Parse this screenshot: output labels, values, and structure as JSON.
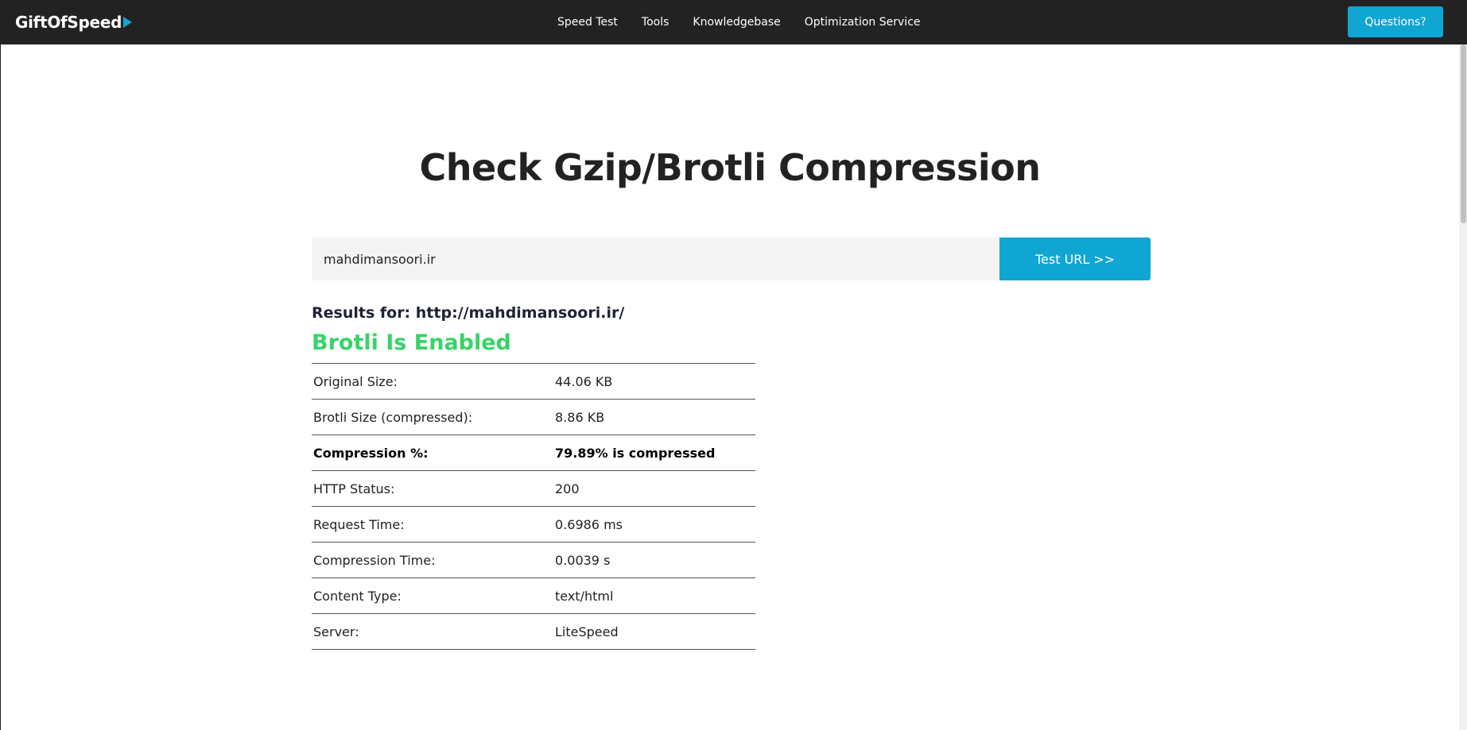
{
  "header": {
    "logo_text": "GiftOfSpeed",
    "nav": [
      {
        "label": "Speed Test"
      },
      {
        "label": "Tools"
      },
      {
        "label": "Knowledgebase"
      },
      {
        "label": "Optimization Service"
      }
    ],
    "questions_label": "Questions?"
  },
  "main": {
    "title": "Check Gzip/Brotli Compression",
    "url_value": "mahdimansoori.ir",
    "test_button_label": "Test URL >>",
    "results_for": "Results for: http://mahdimansoori.ir/",
    "status": "Brotli Is Enabled",
    "results": [
      {
        "label": "Original Size:",
        "value": "44.06 KB"
      },
      {
        "label": "Brotli Size (compressed):",
        "value": "8.86 KB"
      },
      {
        "label": "Compression %:",
        "value": "79.89% is compressed"
      },
      {
        "label": "HTTP Status:",
        "value": "200"
      },
      {
        "label": "Request Time:",
        "value": "0.6986 ms"
      },
      {
        "label": "Compression Time:",
        "value": "0.0039 s"
      },
      {
        "label": "Content Type:",
        "value": "text/html"
      },
      {
        "label": "Server:",
        "value": "LiteSpeed"
      }
    ]
  },
  "colors": {
    "nav_bg": "#222222",
    "accent": "#10a6d3",
    "status_green": "#37d467"
  },
  "icons": {
    "logo_mark": "play-arrow-icon"
  }
}
